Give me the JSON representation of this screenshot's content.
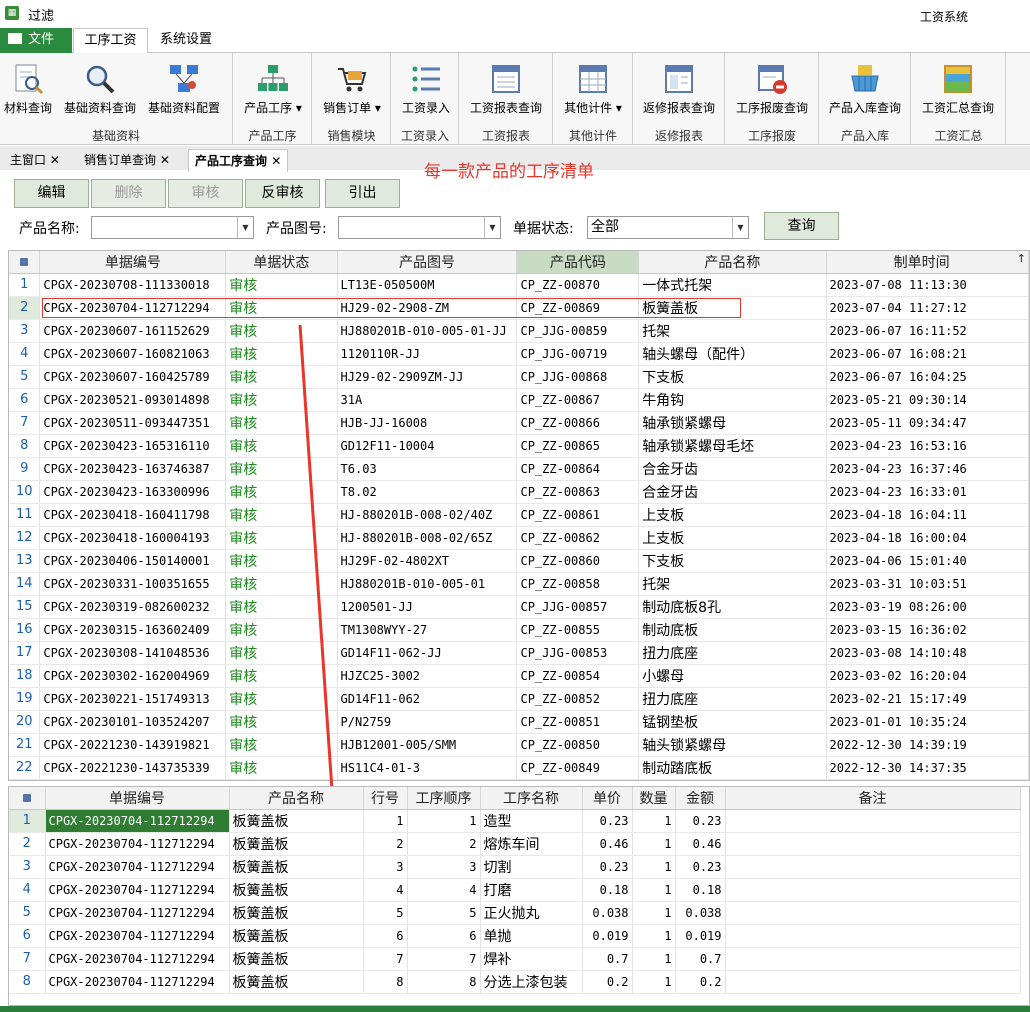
{
  "window": {
    "title": "过滤",
    "system_name": "工资系统",
    "icon": "app-icon"
  },
  "ribbon_tabs": [
    {
      "label": "文件"
    },
    {
      "label": "工序工资"
    },
    {
      "label": "系统设置"
    }
  ],
  "ribbon_groups": [
    {
      "label": "基础资料",
      "buttons": [
        {
          "label": "材料查询",
          "icon": "material-query-icon"
        },
        {
          "label": "基础资料查询",
          "icon": "magnifier-icon"
        },
        {
          "label": "基础资料配置",
          "icon": "network-config-icon"
        }
      ]
    },
    {
      "label": "产品工序",
      "buttons": [
        {
          "label": "产品工序",
          "icon": "org-chart-icon"
        }
      ]
    },
    {
      "label": "销售模块",
      "buttons": [
        {
          "label": "销售订单",
          "icon": "cart-icon"
        }
      ]
    },
    {
      "label": "工资录入",
      "buttons": [
        {
          "label": "工资录入",
          "icon": "list-icon"
        }
      ]
    },
    {
      "label": "工资报表",
      "buttons": [
        {
          "label": "工资报表查询",
          "icon": "report-icon"
        }
      ]
    },
    {
      "label": "其他计件",
      "buttons": [
        {
          "label": "其他计件",
          "icon": "grid-icon"
        }
      ]
    },
    {
      "label": "返修报表",
      "buttons": [
        {
          "label": "返修报表查询",
          "icon": "repair-report-icon"
        }
      ]
    },
    {
      "label": "工序报废",
      "buttons": [
        {
          "label": "工序报废查询",
          "icon": "scrap-icon"
        }
      ]
    },
    {
      "label": "产品入库",
      "buttons": [
        {
          "label": "产品入库查询",
          "icon": "basket-icon"
        }
      ]
    },
    {
      "label": "工资汇总",
      "buttons": [
        {
          "label": "工资汇总查询",
          "icon": "summary-icon"
        }
      ]
    }
  ],
  "doc_tabs": [
    {
      "label": "主窗口"
    },
    {
      "label": "销售订单查询"
    },
    {
      "label": "产品工序查询"
    }
  ],
  "annotation": "每一款产品的工序清单",
  "toolbar": {
    "edit": "编辑",
    "delete": "删除",
    "approve": "审核",
    "unapprove": "反审核",
    "export": "引出"
  },
  "filters": {
    "product_name_label": "产品名称:",
    "product_name_value": "",
    "drawing_no_label": "产品图号:",
    "drawing_no_value": "",
    "status_label": "单据状态:",
    "status_value": "全部",
    "query_button": "查询"
  },
  "master_grid": {
    "columns": [
      "单据编号",
      "单据状态",
      "产品图号",
      "产品代码",
      "产品名称",
      "制单时间"
    ],
    "sort_indicator": "↑",
    "rows": [
      [
        "1",
        "CPGX-20230708-111330018",
        "审核",
        "LT13E-050500M",
        "CP_ZZ-00870",
        "一体式托架",
        "2023-07-08 11:13:30"
      ],
      [
        "2",
        "CPGX-20230704-112712294",
        "审核",
        "HJ29-02-2908-ZM",
        "CP_ZZ-00869",
        "板簧盖板",
        "2023-07-04 11:27:12"
      ],
      [
        "3",
        "CPGX-20230607-161152629",
        "审核",
        "HJ880201B-010-005-01-JJ",
        "CP_JJG-00859",
        "托架",
        "2023-06-07 16:11:52"
      ],
      [
        "4",
        "CPGX-20230607-160821063",
        "审核",
        "1120110R-JJ",
        "CP_JJG-00719",
        "轴头螺母（配件）",
        "2023-06-07 16:08:21"
      ],
      [
        "5",
        "CPGX-20230607-160425789",
        "审核",
        "HJ29-02-2909ZM-JJ",
        "CP_JJG-00868",
        "下支板",
        "2023-06-07 16:04:25"
      ],
      [
        "6",
        "CPGX-20230521-093014898",
        "审核",
        "31A",
        "CP_ZZ-00867",
        "牛角钩",
        "2023-05-21 09:30:14"
      ],
      [
        "7",
        "CPGX-20230511-093447351",
        "审核",
        "HJB-JJ-16008",
        "CP_ZZ-00866",
        "轴承锁紧螺母",
        "2023-05-11 09:34:47"
      ],
      [
        "8",
        "CPGX-20230423-165316110",
        "审核",
        "GD12F11-10004",
        "CP_ZZ-00865",
        "轴承锁紧螺母毛坯",
        "2023-04-23 16:53:16"
      ],
      [
        "9",
        "CPGX-20230423-163746387",
        "审核",
        "T6.03",
        "CP_ZZ-00864",
        "合金牙齿",
        "2023-04-23 16:37:46"
      ],
      [
        "10",
        "CPGX-20230423-163300996",
        "审核",
        "T8.02",
        "CP_ZZ-00863",
        "合金牙齿",
        "2023-04-23 16:33:01"
      ],
      [
        "11",
        "CPGX-20230418-160411798",
        "审核",
        "HJ-880201B-008-02/40Z",
        "CP_ZZ-00861",
        "上支板",
        "2023-04-18 16:04:11"
      ],
      [
        "12",
        "CPGX-20230418-160004193",
        "审核",
        "HJ-880201B-008-02/65Z",
        "CP_ZZ-00862",
        "上支板",
        "2023-04-18 16:00:04"
      ],
      [
        "13",
        "CPGX-20230406-150140001",
        "审核",
        "HJ29F-02-4802XT",
        "CP_ZZ-00860",
        "下支板",
        "2023-04-06 15:01:40"
      ],
      [
        "14",
        "CPGX-20230331-100351655",
        "审核",
        "HJ880201B-010-005-01",
        "CP_ZZ-00858",
        "托架",
        "2023-03-31 10:03:51"
      ],
      [
        "15",
        "CPGX-20230319-082600232",
        "审核",
        "1200501-JJ",
        "CP_JJG-00857",
        "制动底板8孔",
        "2023-03-19 08:26:00"
      ],
      [
        "16",
        "CPGX-20230315-163602409",
        "审核",
        "TM1308WYY-27",
        "CP_ZZ-00855",
        "制动底板",
        "2023-03-15 16:36:02"
      ],
      [
        "17",
        "CPGX-20230308-141048536",
        "审核",
        "GD14F11-062-JJ",
        "CP_JJG-00853",
        "扭力底座",
        "2023-03-08 14:10:48"
      ],
      [
        "18",
        "CPGX-20230302-162004969",
        "审核",
        "HJZC25-3002",
        "CP_ZZ-00854",
        "小螺母",
        "2023-03-02 16:20:04"
      ],
      [
        "19",
        "CPGX-20230221-151749313",
        "审核",
        "GD14F11-062",
        "CP_ZZ-00852",
        "扭力底座",
        "2023-02-21 15:17:49"
      ],
      [
        "20",
        "CPGX-20230101-103524207",
        "审核",
        "P/N2759",
        "CP_ZZ-00851",
        "锰钢垫板",
        "2023-01-01 10:35:24"
      ],
      [
        "21",
        "CPGX-20221230-143919821",
        "审核",
        "HJB12001-005/SMM",
        "CP_ZZ-00850",
        "轴头锁紧螺母",
        "2022-12-30 14:39:19"
      ],
      [
        "22",
        "CPGX-20221230-143735339",
        "审核",
        "HS11C4-01-3",
        "CP_ZZ-00849",
        "制动踏底板",
        "2022-12-30 14:37:35"
      ]
    ]
  },
  "detail_grid": {
    "columns": [
      "单据编号",
      "产品名称",
      "行号",
      "工序顺序",
      "工序名称",
      "单价",
      "数量",
      "金额",
      "备注"
    ],
    "rows": [
      [
        "1",
        "CPGX-20230704-112712294",
        "板簧盖板",
        "1",
        "1",
        "造型",
        "0.23",
        "1",
        "0.23",
        ""
      ],
      [
        "2",
        "CPGX-20230704-112712294",
        "板簧盖板",
        "2",
        "2",
        "熔炼车间",
        "0.46",
        "1",
        "0.46",
        ""
      ],
      [
        "3",
        "CPGX-20230704-112712294",
        "板簧盖板",
        "3",
        "3",
        "切割",
        "0.23",
        "1",
        "0.23",
        ""
      ],
      [
        "4",
        "CPGX-20230704-112712294",
        "板簧盖板",
        "4",
        "4",
        "打磨",
        "0.18",
        "1",
        "0.18",
        ""
      ],
      [
        "5",
        "CPGX-20230704-112712294",
        "板簧盖板",
        "5",
        "5",
        "正火抛丸",
        "0.038",
        "1",
        "0.038",
        ""
      ],
      [
        "6",
        "CPGX-20230704-112712294",
        "板簧盖板",
        "6",
        "6",
        "单抛",
        "0.019",
        "1",
        "0.019",
        ""
      ],
      [
        "7",
        "CPGX-20230704-112712294",
        "板簧盖板",
        "7",
        "7",
        "焊补",
        "0.7",
        "1",
        "0.7",
        ""
      ],
      [
        "8",
        "CPGX-20230704-112712294",
        "板簧盖板",
        "8",
        "8",
        "分选上漆包装",
        "0.2",
        "1",
        "0.2",
        ""
      ]
    ]
  },
  "colors": {
    "brand_green": "#2a8b3e",
    "status_green": "#1d8a1d",
    "annotation_red": "#e8362b",
    "selected_cell": "#2e7d32"
  }
}
